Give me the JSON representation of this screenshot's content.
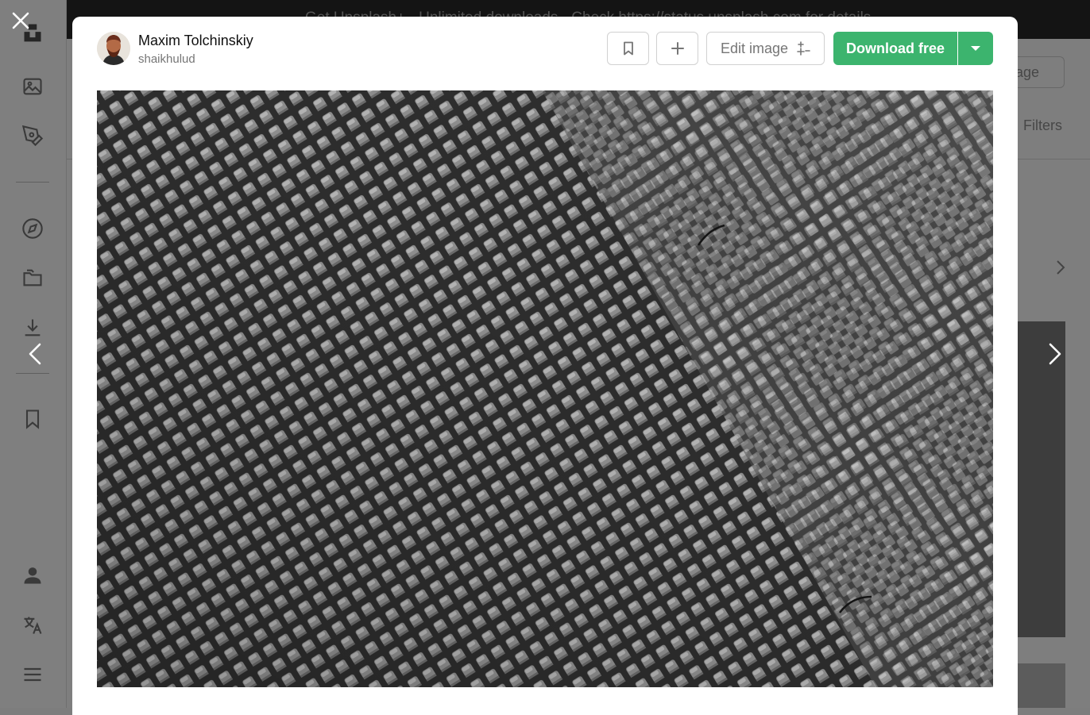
{
  "topbar": {
    "banner_text": "Get Unsplash+ · Unlimited downloads · Check https://status.unsplash.com for details"
  },
  "background": {
    "ghost_button_label": "image",
    "filters_label": "Filters"
  },
  "author": {
    "name": "Maxim Tolchinskiy",
    "username": "shaikhulud"
  },
  "actions": {
    "bookmark_icon": "bookmark-icon",
    "add_icon": "plus-icon",
    "edit_label": "Edit image",
    "download_label": "Download free",
    "dropdown_icon": "chevron-down-icon"
  },
  "photo": {
    "alt": "Close-up of a gray woven mesh texture"
  },
  "colors": {
    "accent": "#3cb46e",
    "overlay": "#7e7e7e"
  }
}
